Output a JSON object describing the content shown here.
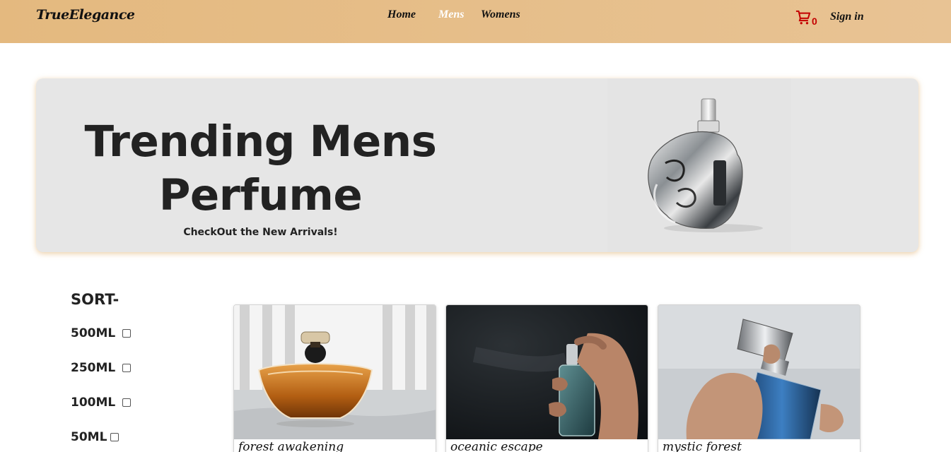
{
  "nav": {
    "brand": "TrueElegance",
    "links": [
      "Home",
      "Mens",
      "Womens"
    ],
    "active": "Mens",
    "cart_count": "0",
    "signin": "Sign in",
    "accent": "#e4b97f",
    "cart_color": "#c40000"
  },
  "hero": {
    "title": "Trending Mens Perfume",
    "subtitle": "CheckOut the New Arrivals!"
  },
  "sort": {
    "title": "SORT-",
    "options": [
      "500ML",
      "250ML",
      "100ML",
      "50ML"
    ]
  },
  "products": [
    {
      "name": "forest awakening"
    },
    {
      "name": "oceanic escape"
    },
    {
      "name": "mystic forest"
    }
  ],
  "icons": {
    "cart": "cart-icon",
    "checkbox": "checkbox"
  }
}
